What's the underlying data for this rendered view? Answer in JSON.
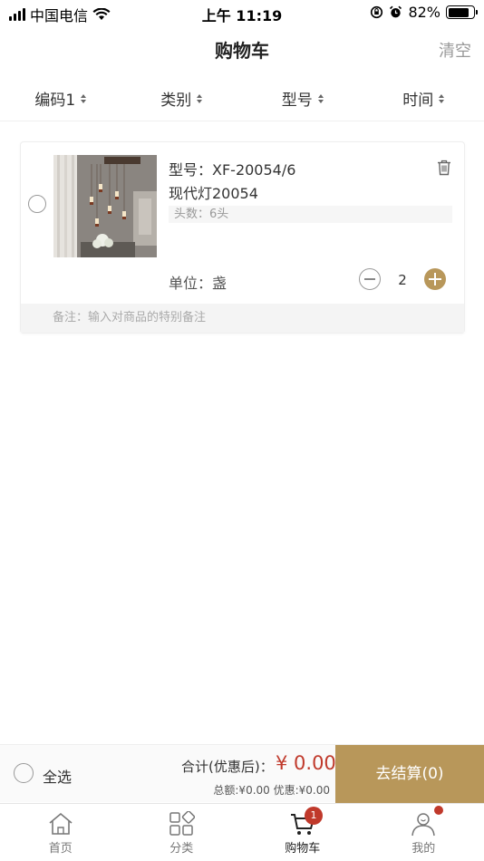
{
  "status_bar": {
    "carrier": "中国电信",
    "time": "上午 11:19",
    "battery": "82%"
  },
  "header": {
    "title": "购物车",
    "clear_label": "清空"
  },
  "sort_bar": {
    "items": [
      {
        "label": "编码1"
      },
      {
        "label": "类别"
      },
      {
        "label": "型号"
      },
      {
        "label": "时间"
      }
    ]
  },
  "cart": {
    "items": [
      {
        "model": "型号：XF-20054/6",
        "name": "现代灯20054",
        "spec": "头数：6头",
        "unit": "单位：盏",
        "quantity": "2",
        "remark_placeholder": "备注：输入对商品的特别备注"
      }
    ]
  },
  "checkout": {
    "select_all": "全选",
    "total_label": "合计(优惠后)：",
    "total_amount": "¥ 0.00",
    "subtotal": "总额:¥0.00 优惠:¥0.00",
    "button_label": "去结算(0)"
  },
  "tab_bar": {
    "tabs": [
      {
        "label": "首页",
        "icon": "home-icon"
      },
      {
        "label": "分类",
        "icon": "category-icon"
      },
      {
        "label": "购物车",
        "icon": "cart-icon",
        "badge": "1"
      },
      {
        "label": "我的",
        "icon": "profile-icon"
      }
    ]
  },
  "colors": {
    "accent": "#b8975a",
    "price": "#c0392b",
    "badge": "#c0392b"
  }
}
